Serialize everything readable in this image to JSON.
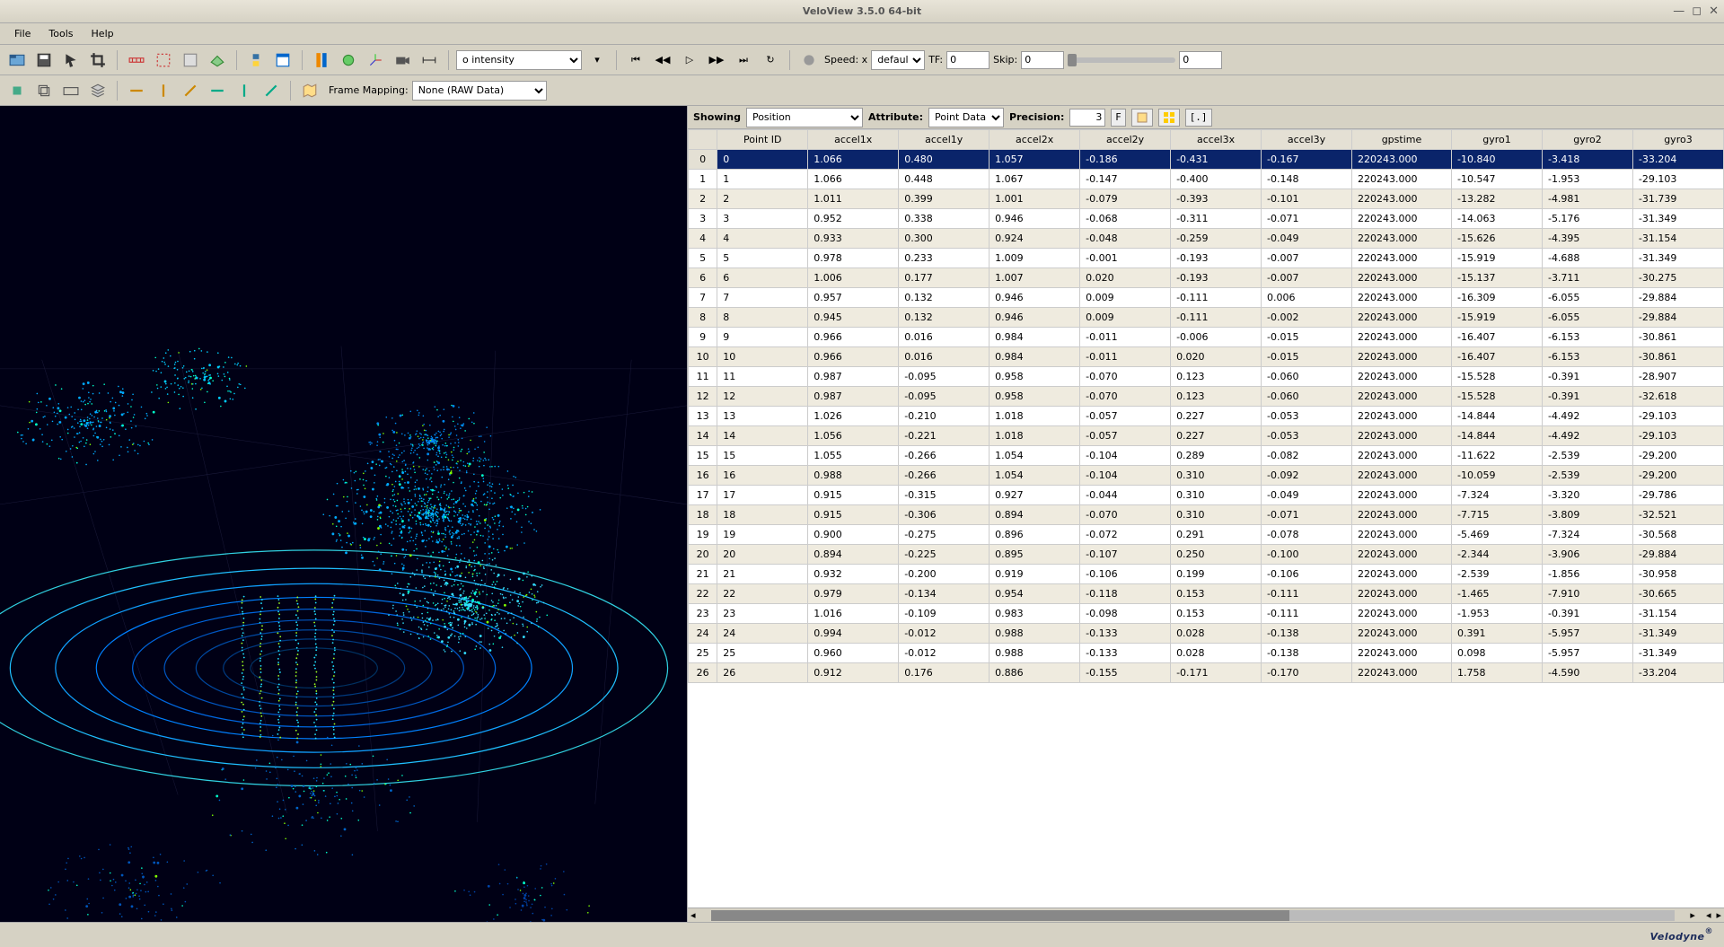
{
  "window": {
    "title": "VeloView 3.5.0 64-bit"
  },
  "menubar": [
    "File",
    "Tools",
    "Help"
  ],
  "toolbar1": {
    "color_select": "o  intensity",
    "speed_label": "Speed: x",
    "speed_value": "default",
    "tf_label": "TF:",
    "tf_value": "0",
    "skip_label": "Skip:",
    "skip_value": "0",
    "frame_value": "0"
  },
  "toolbar2": {
    "frame_mapping_label": "Frame Mapping:",
    "frame_mapping_value": "None (RAW Data)"
  },
  "spreadsheet_bar": {
    "showing_label": "Showing",
    "showing_value": "Position",
    "attribute_label": "Attribute:",
    "attribute_value": "Point Data",
    "precision_label": "Precision:",
    "precision_value": "3",
    "f_button": "F"
  },
  "columns": [
    "Point ID",
    "accel1x",
    "accel1y",
    "accel2x",
    "accel2y",
    "accel3x",
    "accel3y",
    "gpstime",
    "gyro1",
    "gyro2",
    "gyro3"
  ],
  "rows": [
    {
      "idx": "0",
      "cells": [
        "0",
        "1.066",
        "0.480",
        "1.057",
        "-0.186",
        "-0.431",
        "-0.167",
        "220243.000",
        "-10.840",
        "-3.418",
        "-33.204"
      ],
      "sel": true
    },
    {
      "idx": "1",
      "cells": [
        "1",
        "1.066",
        "0.448",
        "1.067",
        "-0.147",
        "-0.400",
        "-0.148",
        "220243.000",
        "-10.547",
        "-1.953",
        "-29.103"
      ]
    },
    {
      "idx": "2",
      "cells": [
        "2",
        "1.011",
        "0.399",
        "1.001",
        "-0.079",
        "-0.393",
        "-0.101",
        "220243.000",
        "-13.282",
        "-4.981",
        "-31.739"
      ]
    },
    {
      "idx": "3",
      "cells": [
        "3",
        "0.952",
        "0.338",
        "0.946",
        "-0.068",
        "-0.311",
        "-0.071",
        "220243.000",
        "-14.063",
        "-5.176",
        "-31.349"
      ]
    },
    {
      "idx": "4",
      "cells": [
        "4",
        "0.933",
        "0.300",
        "0.924",
        "-0.048",
        "-0.259",
        "-0.049",
        "220243.000",
        "-15.626",
        "-4.395",
        "-31.154"
      ]
    },
    {
      "idx": "5",
      "cells": [
        "5",
        "0.978",
        "0.233",
        "1.009",
        "-0.001",
        "-0.193",
        "-0.007",
        "220243.000",
        "-15.919",
        "-4.688",
        "-31.349"
      ]
    },
    {
      "idx": "6",
      "cells": [
        "6",
        "1.006",
        "0.177",
        "1.007",
        "0.020",
        "-0.193",
        "-0.007",
        "220243.000",
        "-15.137",
        "-3.711",
        "-30.275"
      ]
    },
    {
      "idx": "7",
      "cells": [
        "7",
        "0.957",
        "0.132",
        "0.946",
        "0.009",
        "-0.111",
        "0.006",
        "220243.000",
        "-16.309",
        "-6.055",
        "-29.884"
      ]
    },
    {
      "idx": "8",
      "cells": [
        "8",
        "0.945",
        "0.132",
        "0.946",
        "0.009",
        "-0.111",
        "-0.002",
        "220243.000",
        "-15.919",
        "-6.055",
        "-29.884"
      ]
    },
    {
      "idx": "9",
      "cells": [
        "9",
        "0.966",
        "0.016",
        "0.984",
        "-0.011",
        "-0.006",
        "-0.015",
        "220243.000",
        "-16.407",
        "-6.153",
        "-30.861"
      ]
    },
    {
      "idx": "10",
      "cells": [
        "10",
        "0.966",
        "0.016",
        "0.984",
        "-0.011",
        "0.020",
        "-0.015",
        "220243.000",
        "-16.407",
        "-6.153",
        "-30.861"
      ]
    },
    {
      "idx": "11",
      "cells": [
        "11",
        "0.987",
        "-0.095",
        "0.958",
        "-0.070",
        "0.123",
        "-0.060",
        "220243.000",
        "-15.528",
        "-0.391",
        "-28.907"
      ]
    },
    {
      "idx": "12",
      "cells": [
        "12",
        "0.987",
        "-0.095",
        "0.958",
        "-0.070",
        "0.123",
        "-0.060",
        "220243.000",
        "-15.528",
        "-0.391",
        "-32.618"
      ]
    },
    {
      "idx": "13",
      "cells": [
        "13",
        "1.026",
        "-0.210",
        "1.018",
        "-0.057",
        "0.227",
        "-0.053",
        "220243.000",
        "-14.844",
        "-4.492",
        "-29.103"
      ]
    },
    {
      "idx": "14",
      "cells": [
        "14",
        "1.056",
        "-0.221",
        "1.018",
        "-0.057",
        "0.227",
        "-0.053",
        "220243.000",
        "-14.844",
        "-4.492",
        "-29.103"
      ]
    },
    {
      "idx": "15",
      "cells": [
        "15",
        "1.055",
        "-0.266",
        "1.054",
        "-0.104",
        "0.289",
        "-0.082",
        "220243.000",
        "-11.622",
        "-2.539",
        "-29.200"
      ]
    },
    {
      "idx": "16",
      "cells": [
        "16",
        "0.988",
        "-0.266",
        "1.054",
        "-0.104",
        "0.310",
        "-0.092",
        "220243.000",
        "-10.059",
        "-2.539",
        "-29.200"
      ]
    },
    {
      "idx": "17",
      "cells": [
        "17",
        "0.915",
        "-0.315",
        "0.927",
        "-0.044",
        "0.310",
        "-0.049",
        "220243.000",
        "-7.324",
        "-3.320",
        "-29.786"
      ]
    },
    {
      "idx": "18",
      "cells": [
        "18",
        "0.915",
        "-0.306",
        "0.894",
        "-0.070",
        "0.310",
        "-0.071",
        "220243.000",
        "-7.715",
        "-3.809",
        "-32.521"
      ]
    },
    {
      "idx": "19",
      "cells": [
        "19",
        "0.900",
        "-0.275",
        "0.896",
        "-0.072",
        "0.291",
        "-0.078",
        "220243.000",
        "-5.469",
        "-7.324",
        "-30.568"
      ]
    },
    {
      "idx": "20",
      "cells": [
        "20",
        "0.894",
        "-0.225",
        "0.895",
        "-0.107",
        "0.250",
        "-0.100",
        "220243.000",
        "-2.344",
        "-3.906",
        "-29.884"
      ]
    },
    {
      "idx": "21",
      "cells": [
        "21",
        "0.932",
        "-0.200",
        "0.919",
        "-0.106",
        "0.199",
        "-0.106",
        "220243.000",
        "-2.539",
        "-1.856",
        "-30.958"
      ]
    },
    {
      "idx": "22",
      "cells": [
        "22",
        "0.979",
        "-0.134",
        "0.954",
        "-0.118",
        "0.153",
        "-0.111",
        "220243.000",
        "-1.465",
        "-7.910",
        "-30.665"
      ]
    },
    {
      "idx": "23",
      "cells": [
        "23",
        "1.016",
        "-0.109",
        "0.983",
        "-0.098",
        "0.153",
        "-0.111",
        "220243.000",
        "-1.953",
        "-0.391",
        "-31.154"
      ]
    },
    {
      "idx": "24",
      "cells": [
        "24",
        "0.994",
        "-0.012",
        "0.988",
        "-0.133",
        "0.028",
        "-0.138",
        "220243.000",
        "0.391",
        "-5.957",
        "-31.349"
      ]
    },
    {
      "idx": "25",
      "cells": [
        "25",
        "0.960",
        "-0.012",
        "0.988",
        "-0.133",
        "0.028",
        "-0.138",
        "220243.000",
        "0.098",
        "-5.957",
        "-31.349"
      ]
    },
    {
      "idx": "26",
      "cells": [
        "26",
        "0.912",
        "0.176",
        "0.886",
        "-0.155",
        "-0.171",
        "-0.170",
        "220243.000",
        "1.758",
        "-4.590",
        "-33.204"
      ]
    }
  ],
  "footer": {
    "brand": "Velodyne"
  }
}
